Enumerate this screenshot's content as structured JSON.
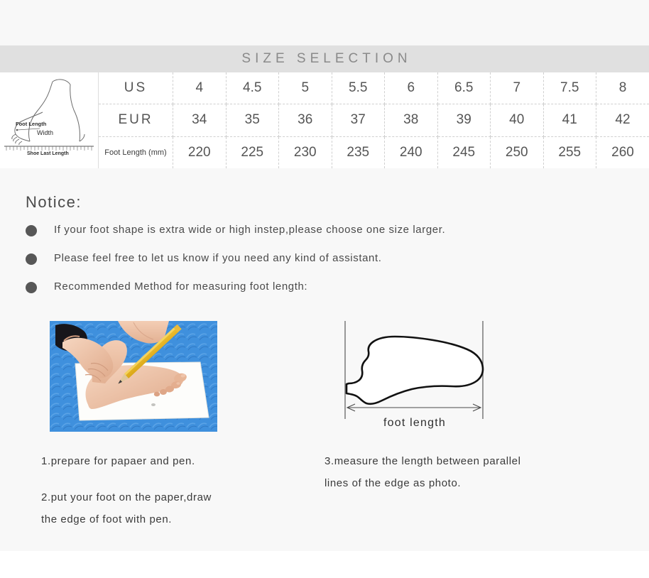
{
  "banner": {
    "title": "SIZE SELECTION"
  },
  "size_table": {
    "diagram": {
      "foot_length_label": "Foot Length",
      "width_label": "Width",
      "shoe_last_length_label": "Shoe Last Length"
    },
    "rows": [
      {
        "label": "US",
        "values": [
          "4",
          "4.5",
          "5",
          "5.5",
          "6",
          "6.5",
          "7",
          "7.5",
          "8"
        ]
      },
      {
        "label": "EUR",
        "values": [
          "34",
          "35",
          "36",
          "37",
          "38",
          "39",
          "40",
          "41",
          "42"
        ]
      },
      {
        "label": "Foot Length  (mm)",
        "values": [
          "220",
          "225",
          "230",
          "235",
          "240",
          "245",
          "250",
          "255",
          "260"
        ]
      }
    ]
  },
  "notice": {
    "heading": "Notice:",
    "items": [
      "If your foot shape is extra wide or high instep,please choose one size larger.",
      "Please feel free to let us know if you need any kind of assistant.",
      "Recommended Method for measuring foot length:"
    ]
  },
  "figures": {
    "outline_caption": "foot length"
  },
  "steps": {
    "left": [
      "1.prepare for papaer and pen.",
      "2.put your foot on the paper,draw\nthe edge of foot with pen."
    ],
    "right": [
      "3.measure the length between parallel\nlines of the edge as photo."
    ]
  },
  "colors": {
    "page_background": "#f8f8f8",
    "banner_background": "#e0e0e0",
    "banner_text": "#8a8a8a",
    "table_background": "#ffffff",
    "grid_dashed": "#cfcfcf",
    "bullet": "#575757",
    "body_text": "#4a4a4a",
    "photo_mat": "#3d8fdb"
  }
}
